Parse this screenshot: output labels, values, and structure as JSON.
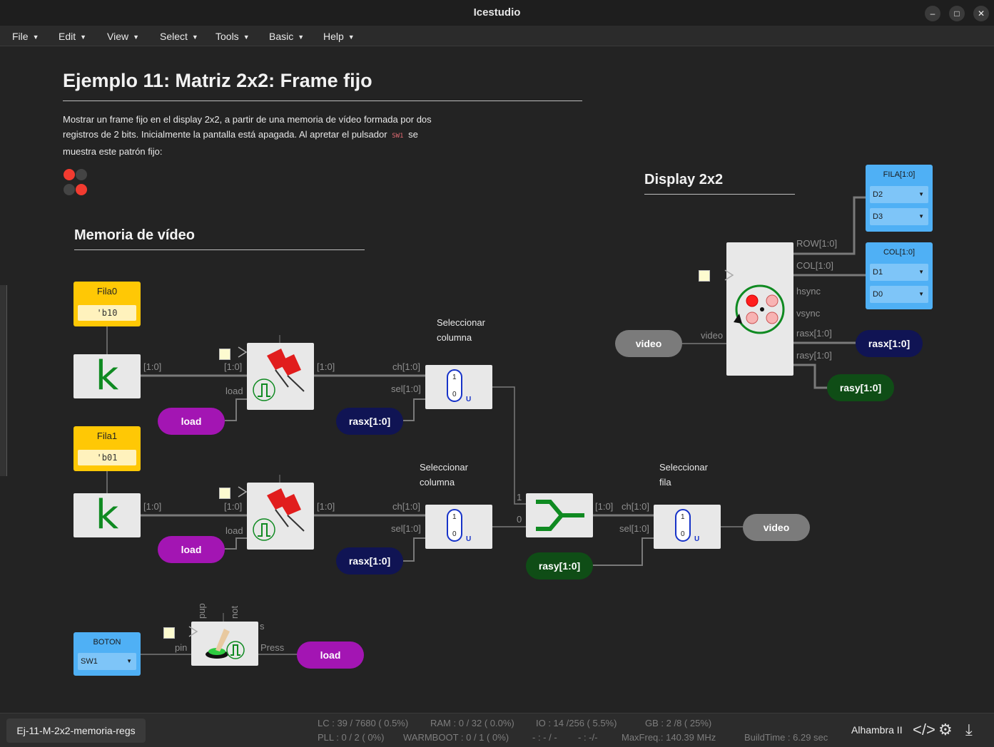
{
  "window": {
    "title": "Icestudio"
  },
  "menu": [
    "File",
    "Edit",
    "View",
    "Select",
    "Tools",
    "Basic",
    "Help"
  ],
  "doc": {
    "title": "Ejemplo 11: Matriz 2x2: Frame fijo",
    "desc_part1": "Mostrar un frame fijo en el display 2x2, a partir de una memoria de vídeo formada por dos registros de 2 bits. Inicialmente la pantalla está apagada. Al apretar el pulsador",
    "desc_code": "SW1",
    "desc_part2": "se muestra este patrón fijo:",
    "pattern": [
      [
        true,
        false
      ],
      [
        false,
        true
      ]
    ],
    "colors": {
      "on": "#f23b30",
      "off": "#444444"
    }
  },
  "sections": {
    "memoria": "Memoria de vídeo",
    "display": "Display 2x2"
  },
  "constants": [
    {
      "name": "Fila0",
      "value": "'b10"
    },
    {
      "name": "Fila1",
      "value": "'b01"
    }
  ],
  "k_label": "k",
  "wire_labels": {
    "bus": "[1:0]",
    "load": "load",
    "ch": "ch[1:0]",
    "sel": "sel[1:0]",
    "one": "1",
    "zero": "0",
    "pin": "pin",
    "pup": "pup",
    "not": "not",
    "s": "s",
    "press": "Press",
    "row": "ROW[1:0]",
    "col": "COL[1:0]",
    "hsync": "hsync",
    "vsync": "vsync",
    "rasx": "rasx[1:0]",
    "rasy": "rasy[1:0]",
    "video": "video"
  },
  "comments": {
    "sel_col_a": "Seleccionar",
    "sel_col_b": "columna",
    "sel_row_a": "Seleccionar",
    "sel_row_b": "fila"
  },
  "mux": {
    "in1": "1",
    "in0": "0",
    "u": "U"
  },
  "pills": {
    "load": "load",
    "rasx": "rasx[1:0]",
    "rasy": "rasy[1:0]",
    "video": "video"
  },
  "io": {
    "boton": {
      "name": "BOTON",
      "pin": "SW1"
    },
    "fila": {
      "name": "FILA[1:0]",
      "pins": [
        "D2",
        "D3"
      ]
    },
    "col": {
      "name": "COL[1:0]",
      "pins": [
        "D1",
        "D0"
      ]
    }
  },
  "status": {
    "project": "Ej-11-M-2x2-memoria-regs",
    "lc": "LC : 39 / 7680 ( 0.5%)",
    "ram": "RAM : 0 / 32 ( 0.0%)",
    "io": "IO :  14 /256  ( 5.5%)",
    "gb": "GB :  2 /8  ( 25%)",
    "pll": "PLL : 0 / 2 ( 0%)",
    "warmboot": "WARMBOOT : 0 / 1 ( 0%)",
    "blank1": "- : - / -",
    "blank2": "- :  -/-",
    "maxfreq": "MaxFreq.:  140.39 MHz",
    "buildtime": "BuildTime :  6.29 sec",
    "board": "Alhambra II"
  },
  "icons": {
    "code": "code-icon",
    "gear": "gear-icon",
    "upload": "upload-icon",
    "minimize": "minimize-icon",
    "maximize": "maximize-icon",
    "close": "close-icon"
  }
}
